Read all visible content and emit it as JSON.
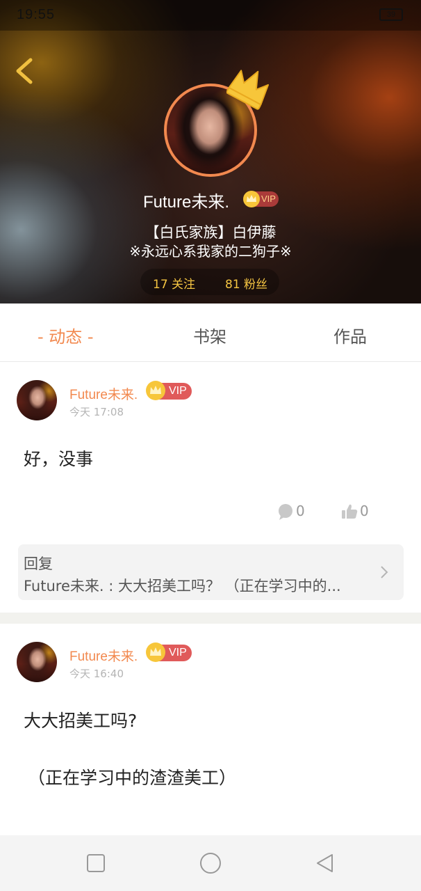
{
  "status_bar": {
    "time": "19:55",
    "battery": "39"
  },
  "profile": {
    "name": "Future未来.",
    "vip_label": "VIP",
    "bio_line1": "【白氏家族】白伊藤",
    "bio_line2": "※永远心系我家的二狗子※",
    "follow": "17 关注",
    "fans": "81 粉丝"
  },
  "tabs": [
    {
      "label": "- 动态 -",
      "active": true
    },
    {
      "label": "书架",
      "active": false
    },
    {
      "label": "作品",
      "active": false
    }
  ],
  "posts": [
    {
      "author": "Future未来.",
      "vip_label": "VIP",
      "time": "今天 17:08",
      "text": "好，没事",
      "comments": "0",
      "likes": "0",
      "reply_label": "回复",
      "reply_text": "Future未来. : 大大招美工吗？ （正在学习中的..."
    },
    {
      "author": "Future未来.",
      "vip_label": "VIP",
      "time": "今天 16:40",
      "text_line1": "大大招美工吗?",
      "text_line2": "（正在学习中的渣渣美工）"
    }
  ],
  "colors": {
    "accent": "#f2894f",
    "vip_red": "#e05a5a",
    "gold": "#f5c542"
  },
  "icons": [
    "back-arrow-icon",
    "crown-icon",
    "comment-icon",
    "thumbs-up-icon",
    "chevron-right-icon",
    "square-icon",
    "circle-icon",
    "triangle-back-icon"
  ]
}
